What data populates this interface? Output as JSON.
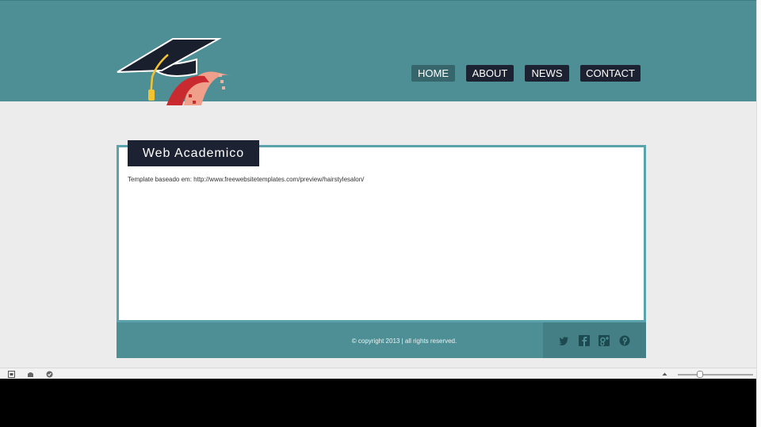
{
  "nav": {
    "home": "HOME",
    "about": "ABOUT",
    "news": "NEWS",
    "contact": "CONTACT"
  },
  "main": {
    "title": "Web Academico",
    "text": "Template baseado em: http://www.freewebsitetemplates.com/preview/hairstylesalon/"
  },
  "footer": {
    "copyright": "© copyright 2013 | all rights reserved."
  },
  "colors": {
    "header": "#4e8f96",
    "nav_active": "#36666c",
    "nav_dark": "#1d2233",
    "box_border": "#5aa3ad"
  },
  "icons": [
    "twitter-icon",
    "facebook-icon",
    "google-plus-icon",
    "pinterest-icon"
  ]
}
